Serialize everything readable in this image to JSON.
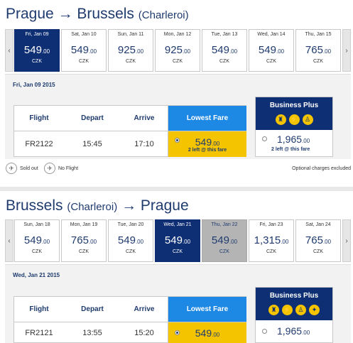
{
  "outbound": {
    "from": "Prague",
    "to": "Brussels",
    "to_sub": "(Charleroi)",
    "arrow": "→",
    "days": [
      {
        "label": "Fri, Jan 09",
        "price": "549",
        "dec": ".00",
        "currency": "CZK",
        "state": "selected"
      },
      {
        "label": "Sat, Jan 10",
        "price": "549",
        "dec": ".00",
        "currency": "CZK",
        "state": "normal"
      },
      {
        "label": "Sun, Jan 11",
        "price": "925",
        "dec": ".00",
        "currency": "CZK",
        "state": "normal"
      },
      {
        "label": "Mon, Jan 12",
        "price": "925",
        "dec": ".00",
        "currency": "CZK",
        "state": "normal"
      },
      {
        "label": "Tue, Jan 13",
        "price": "549",
        "dec": ".00",
        "currency": "CZK",
        "state": "normal"
      },
      {
        "label": "Wed, Jan 14",
        "price": "549",
        "dec": ".00",
        "currency": "CZK",
        "state": "normal"
      },
      {
        "label": "Thu, Jan 15",
        "price": "765",
        "dec": ".00",
        "currency": "CZK",
        "state": "normal"
      }
    ],
    "date_heading": "Fri, Jan 09 2015",
    "flight": "FR2122",
    "depart": "15:45",
    "arrive": "17:10",
    "lowest_price": "549",
    "lowest_dec": ".00",
    "lowest_note": "2 left @ this fare",
    "bplus_price": "1,965",
    "bplus_dec": ".00",
    "bplus_note": "2 left @ this fare"
  },
  "inbound": {
    "from": "Brussels",
    "from_sub": "(Charleroi)",
    "to": "Prague",
    "arrow": "→",
    "days": [
      {
        "label": "Sun, Jan 18",
        "price": "549",
        "dec": ".00",
        "currency": "CZK",
        "state": "normal"
      },
      {
        "label": "Mon, Jan 19",
        "price": "765",
        "dec": ".00",
        "currency": "CZK",
        "state": "normal"
      },
      {
        "label": "Tue, Jan 20",
        "price": "549",
        "dec": ".00",
        "currency": "CZK",
        "state": "normal"
      },
      {
        "label": "Wed, Jan 21",
        "price": "549",
        "dec": ".00",
        "currency": "CZK",
        "state": "selected"
      },
      {
        "label": "Thu, Jan 22",
        "price": "549",
        "dec": ".00",
        "currency": "CZK",
        "state": "grey"
      },
      {
        "label": "Fri, Jan 23",
        "price": "1,315",
        "dec": ".00",
        "currency": "CZK",
        "state": "normal"
      },
      {
        "label": "Sat, Jan 24",
        "price": "765",
        "dec": ".00",
        "currency": "CZK",
        "state": "normal"
      }
    ],
    "date_heading": "Wed, Jan 21 2015",
    "flight": "FR2121",
    "depart": "13:55",
    "arrive": "15:20",
    "lowest_price": "549",
    "lowest_dec": ".00",
    "bplus_price": "1,965",
    "bplus_dec": ".00"
  },
  "table_headers": {
    "flight": "Flight",
    "depart": "Depart",
    "arrive": "Arrive",
    "lowest": "Lowest Fare",
    "bplus": "Business Plus"
  },
  "legend": {
    "sold_out": "Sold out",
    "no_flight": "No Flight",
    "optional": "Optional charges excluded"
  },
  "nav": {
    "left": "‹",
    "right": "›"
  },
  "icons": [
    "baggage-icon",
    "priority-icon",
    "seat-icon",
    "fasttrack-icon"
  ],
  "colors": {
    "navy": "#0e2f73",
    "blue": "#1e88e5",
    "yellow": "#f4c400",
    "grey": "#b4b4b4"
  }
}
